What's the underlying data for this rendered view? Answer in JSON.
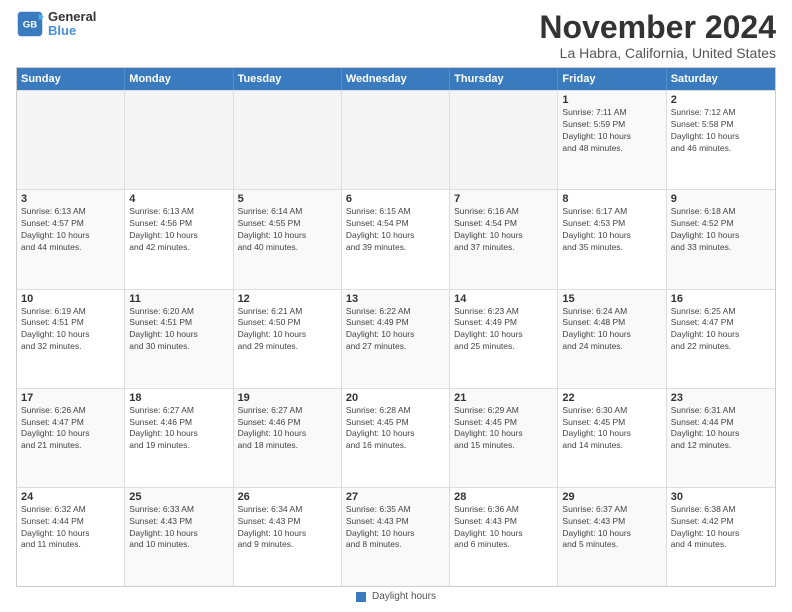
{
  "header": {
    "logo_line1": "General",
    "logo_line2": "Blue",
    "title": "November 2024",
    "subtitle": "La Habra, California, United States"
  },
  "calendar": {
    "days_of_week": [
      "Sunday",
      "Monday",
      "Tuesday",
      "Wednesday",
      "Thursday",
      "Friday",
      "Saturday"
    ],
    "weeks": [
      [
        {
          "day": "",
          "info": "",
          "empty": true
        },
        {
          "day": "",
          "info": "",
          "empty": true
        },
        {
          "day": "",
          "info": "",
          "empty": true
        },
        {
          "day": "",
          "info": "",
          "empty": true
        },
        {
          "day": "",
          "info": "",
          "empty": true
        },
        {
          "day": "1",
          "info": "Sunrise: 7:11 AM\nSunset: 5:59 PM\nDaylight: 10 hours\nand 48 minutes."
        },
        {
          "day": "2",
          "info": "Sunrise: 7:12 AM\nSunset: 5:58 PM\nDaylight: 10 hours\nand 46 minutes."
        }
      ],
      [
        {
          "day": "3",
          "info": "Sunrise: 6:13 AM\nSunset: 4:57 PM\nDaylight: 10 hours\nand 44 minutes."
        },
        {
          "day": "4",
          "info": "Sunrise: 6:13 AM\nSunset: 4:56 PM\nDaylight: 10 hours\nand 42 minutes."
        },
        {
          "day": "5",
          "info": "Sunrise: 6:14 AM\nSunset: 4:55 PM\nDaylight: 10 hours\nand 40 minutes."
        },
        {
          "day": "6",
          "info": "Sunrise: 6:15 AM\nSunset: 4:54 PM\nDaylight: 10 hours\nand 39 minutes."
        },
        {
          "day": "7",
          "info": "Sunrise: 6:16 AM\nSunset: 4:54 PM\nDaylight: 10 hours\nand 37 minutes."
        },
        {
          "day": "8",
          "info": "Sunrise: 6:17 AM\nSunset: 4:53 PM\nDaylight: 10 hours\nand 35 minutes."
        },
        {
          "day": "9",
          "info": "Sunrise: 6:18 AM\nSunset: 4:52 PM\nDaylight: 10 hours\nand 33 minutes."
        }
      ],
      [
        {
          "day": "10",
          "info": "Sunrise: 6:19 AM\nSunset: 4:51 PM\nDaylight: 10 hours\nand 32 minutes."
        },
        {
          "day": "11",
          "info": "Sunrise: 6:20 AM\nSunset: 4:51 PM\nDaylight: 10 hours\nand 30 minutes."
        },
        {
          "day": "12",
          "info": "Sunrise: 6:21 AM\nSunset: 4:50 PM\nDaylight: 10 hours\nand 29 minutes."
        },
        {
          "day": "13",
          "info": "Sunrise: 6:22 AM\nSunset: 4:49 PM\nDaylight: 10 hours\nand 27 minutes."
        },
        {
          "day": "14",
          "info": "Sunrise: 6:23 AM\nSunset: 4:49 PM\nDaylight: 10 hours\nand 25 minutes."
        },
        {
          "day": "15",
          "info": "Sunrise: 6:24 AM\nSunset: 4:48 PM\nDaylight: 10 hours\nand 24 minutes."
        },
        {
          "day": "16",
          "info": "Sunrise: 6:25 AM\nSunset: 4:47 PM\nDaylight: 10 hours\nand 22 minutes."
        }
      ],
      [
        {
          "day": "17",
          "info": "Sunrise: 6:26 AM\nSunset: 4:47 PM\nDaylight: 10 hours\nand 21 minutes."
        },
        {
          "day": "18",
          "info": "Sunrise: 6:27 AM\nSunset: 4:46 PM\nDaylight: 10 hours\nand 19 minutes."
        },
        {
          "day": "19",
          "info": "Sunrise: 6:27 AM\nSunset: 4:46 PM\nDaylight: 10 hours\nand 18 minutes."
        },
        {
          "day": "20",
          "info": "Sunrise: 6:28 AM\nSunset: 4:45 PM\nDaylight: 10 hours\nand 16 minutes."
        },
        {
          "day": "21",
          "info": "Sunrise: 6:29 AM\nSunset: 4:45 PM\nDaylight: 10 hours\nand 15 minutes."
        },
        {
          "day": "22",
          "info": "Sunrise: 6:30 AM\nSunset: 4:45 PM\nDaylight: 10 hours\nand 14 minutes."
        },
        {
          "day": "23",
          "info": "Sunrise: 6:31 AM\nSunset: 4:44 PM\nDaylight: 10 hours\nand 12 minutes."
        }
      ],
      [
        {
          "day": "24",
          "info": "Sunrise: 6:32 AM\nSunset: 4:44 PM\nDaylight: 10 hours\nand 11 minutes."
        },
        {
          "day": "25",
          "info": "Sunrise: 6:33 AM\nSunset: 4:43 PM\nDaylight: 10 hours\nand 10 minutes."
        },
        {
          "day": "26",
          "info": "Sunrise: 6:34 AM\nSunset: 4:43 PM\nDaylight: 10 hours\nand 9 minutes."
        },
        {
          "day": "27",
          "info": "Sunrise: 6:35 AM\nSunset: 4:43 PM\nDaylight: 10 hours\nand 8 minutes."
        },
        {
          "day": "28",
          "info": "Sunrise: 6:36 AM\nSunset: 4:43 PM\nDaylight: 10 hours\nand 6 minutes."
        },
        {
          "day": "29",
          "info": "Sunrise: 6:37 AM\nSunset: 4:43 PM\nDaylight: 10 hours\nand 5 minutes."
        },
        {
          "day": "30",
          "info": "Sunrise: 6:38 AM\nSunset: 4:42 PM\nDaylight: 10 hours\nand 4 minutes."
        }
      ]
    ]
  },
  "footer": {
    "legend_label": "Daylight hours"
  }
}
